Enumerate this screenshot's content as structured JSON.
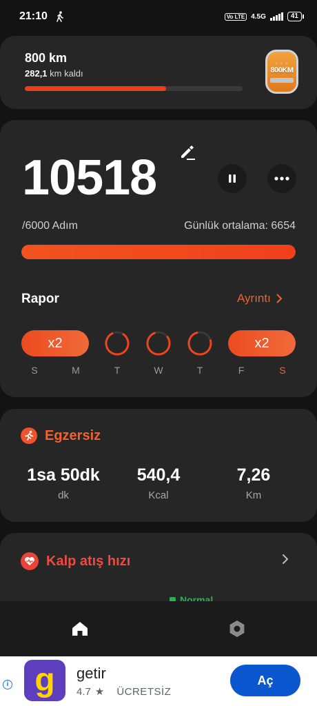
{
  "status_bar": {
    "time": "21:10",
    "network": "4.5G",
    "volte": "Vo LTE",
    "battery": "41"
  },
  "goal": {
    "title": "800 km",
    "remaining_value": "282,1",
    "remaining_text": "km kaldı",
    "progress": 0.65,
    "badge_text": "800KM",
    "accent": "#e8401e"
  },
  "steps": {
    "count": "10518",
    "goal_text": "/6000 Adım",
    "average_text": "Günlük ortalama: 6654",
    "progress": 1.0
  },
  "report": {
    "title": "Rapor",
    "link": "Ayrıntı",
    "days": [
      {
        "label": "S",
        "type": "pill",
        "text": "x2"
      },
      {
        "label": "M",
        "type": "pill",
        "text": ""
      },
      {
        "label": "T",
        "type": "ring"
      },
      {
        "label": "W",
        "type": "ring"
      },
      {
        "label": "T",
        "type": "ring"
      },
      {
        "label": "F",
        "type": "pill",
        "text": "x2"
      },
      {
        "label": "S",
        "type": "pill",
        "active": true
      }
    ],
    "pill_left_text": "x2",
    "pill_right_text": "x2"
  },
  "exercise": {
    "title": "Egzersiz",
    "stats": [
      {
        "value": "1sa 50dk",
        "unit": "dk"
      },
      {
        "value": "540,4",
        "unit": "Kcal"
      },
      {
        "value": "7,26",
        "unit": "Km"
      }
    ]
  },
  "heart": {
    "title": "Kalp atış hızı",
    "status": "Normal"
  },
  "ad": {
    "logo_glyph": "g",
    "name": "getir",
    "rating": "4.7",
    "price": "ÜCRETSİZ",
    "button": "Aç",
    "info": "i"
  },
  "colors": {
    "accent": "#f2622e",
    "card": "#262626",
    "bg": "#131313",
    "heart": "#ef4a3f",
    "normal": "#2fae55"
  }
}
